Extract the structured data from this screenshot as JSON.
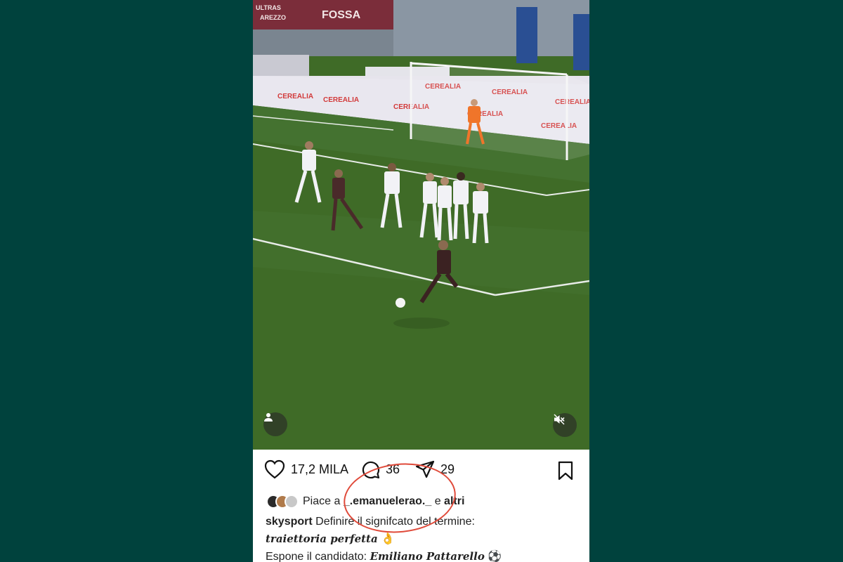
{
  "post": {
    "likes_count": "17,2 MILA",
    "comments_count": "36",
    "shares_count": "29",
    "liked_by_prefix": "Piace a",
    "liked_by_user": "_.emanuelerao._",
    "liked_by_and": "e",
    "liked_by_others": "altri",
    "author": "skysport",
    "caption_line1": "Definire il signifcato del termine:",
    "caption_emph": "traiettoria perfetta",
    "caption_emoji": "👌",
    "caption_line3_prefix": "Espone il candidato:",
    "caption_candidate": "Emiliano Pattarello",
    "caption_ball": "⚽"
  },
  "video": {
    "banner_texts": [
      "ULTRAS",
      "AREZZO",
      "FOSSA",
      "CEREALIA",
      "CEREALIA",
      "CEREALIA",
      "CEREALIA",
      "CEREALIA",
      "CEREALIA",
      "CEREALIA",
      "CEREALIA"
    ],
    "muted": true
  },
  "icons": {
    "like": "heart-icon",
    "comment": "comment-icon",
    "share": "paper-plane-icon",
    "save": "bookmark-icon",
    "tagged": "user-icon",
    "mute": "speaker-muted-icon"
  },
  "colors": {
    "background": "#00423d",
    "pitch": "#3f6b27",
    "annotation": "#e04a3a"
  }
}
